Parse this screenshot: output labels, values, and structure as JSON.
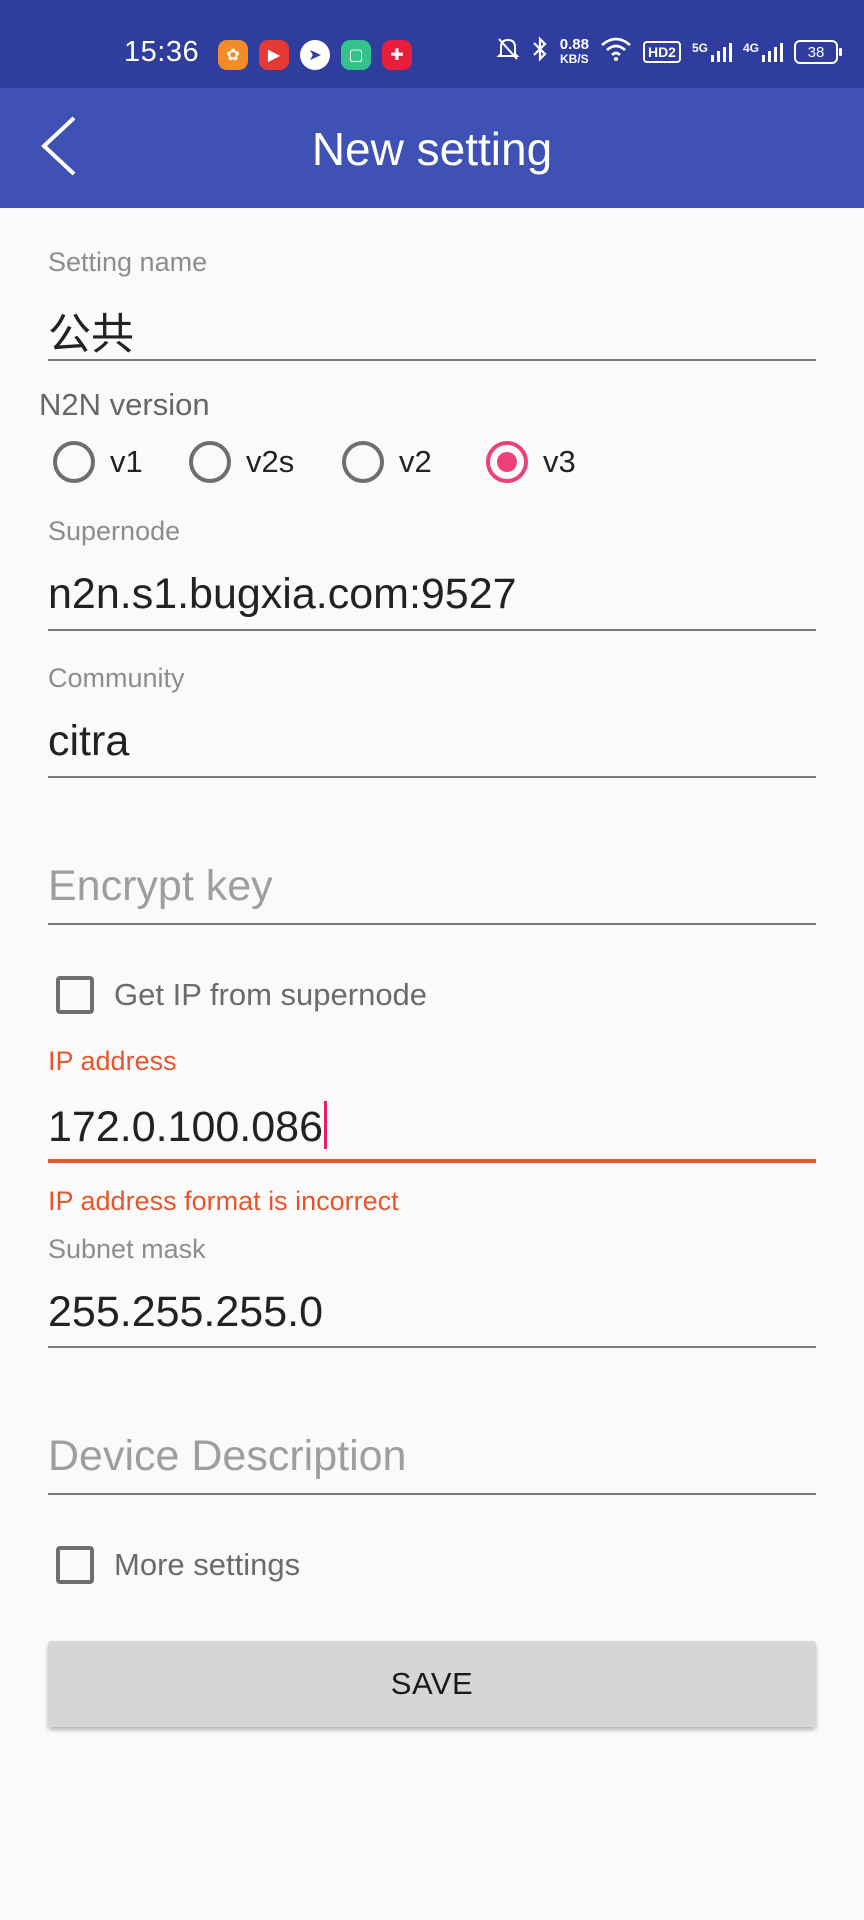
{
  "status_bar": {
    "time": "15:36",
    "net_speed_value": "0.88",
    "net_speed_unit": "KB/S",
    "hd_badge": "HD2",
    "signal_5g": "5G",
    "signal_4g": "4G",
    "battery": "38",
    "app_icons": [
      "uc-browser-icon",
      "video-app-icon",
      "bird-app-icon",
      "chat-app-icon",
      "red-app-icon"
    ],
    "system_icons": [
      "mute-bell-icon",
      "bluetooth-icon",
      "wifi-icon"
    ]
  },
  "app_bar": {
    "title": "New setting",
    "back_icon": "chevron-left-icon"
  },
  "form": {
    "setting_name": {
      "label": "Setting name",
      "value": "公共"
    },
    "n2n_version": {
      "label": "N2N version",
      "options": [
        "v1",
        "v2s",
        "v2",
        "v3"
      ],
      "selected": "v3"
    },
    "supernode": {
      "label": "Supernode",
      "value": "n2n.s1.bugxia.com:9527"
    },
    "community": {
      "label": "Community",
      "value": "citra"
    },
    "encrypt_key": {
      "placeholder": "Encrypt key"
    },
    "get_ip_from_supernode": {
      "label": "Get IP from supernode",
      "checked": false
    },
    "ip_address": {
      "label": "IP address",
      "value": "172.0.100.086",
      "error": "IP address format is incorrect"
    },
    "subnet_mask": {
      "label": "Subnet mask",
      "value": "255.255.255.0"
    },
    "device_description": {
      "placeholder": "Device Description"
    },
    "more_settings": {
      "label": "More settings",
      "checked": false
    },
    "save_label": "SAVE"
  },
  "colors": {
    "status_bar": "#2f3e9e",
    "app_bar": "#3f51b5",
    "accent": "#ec407a",
    "error": "#e8552d",
    "button": "#d6d6d6"
  }
}
